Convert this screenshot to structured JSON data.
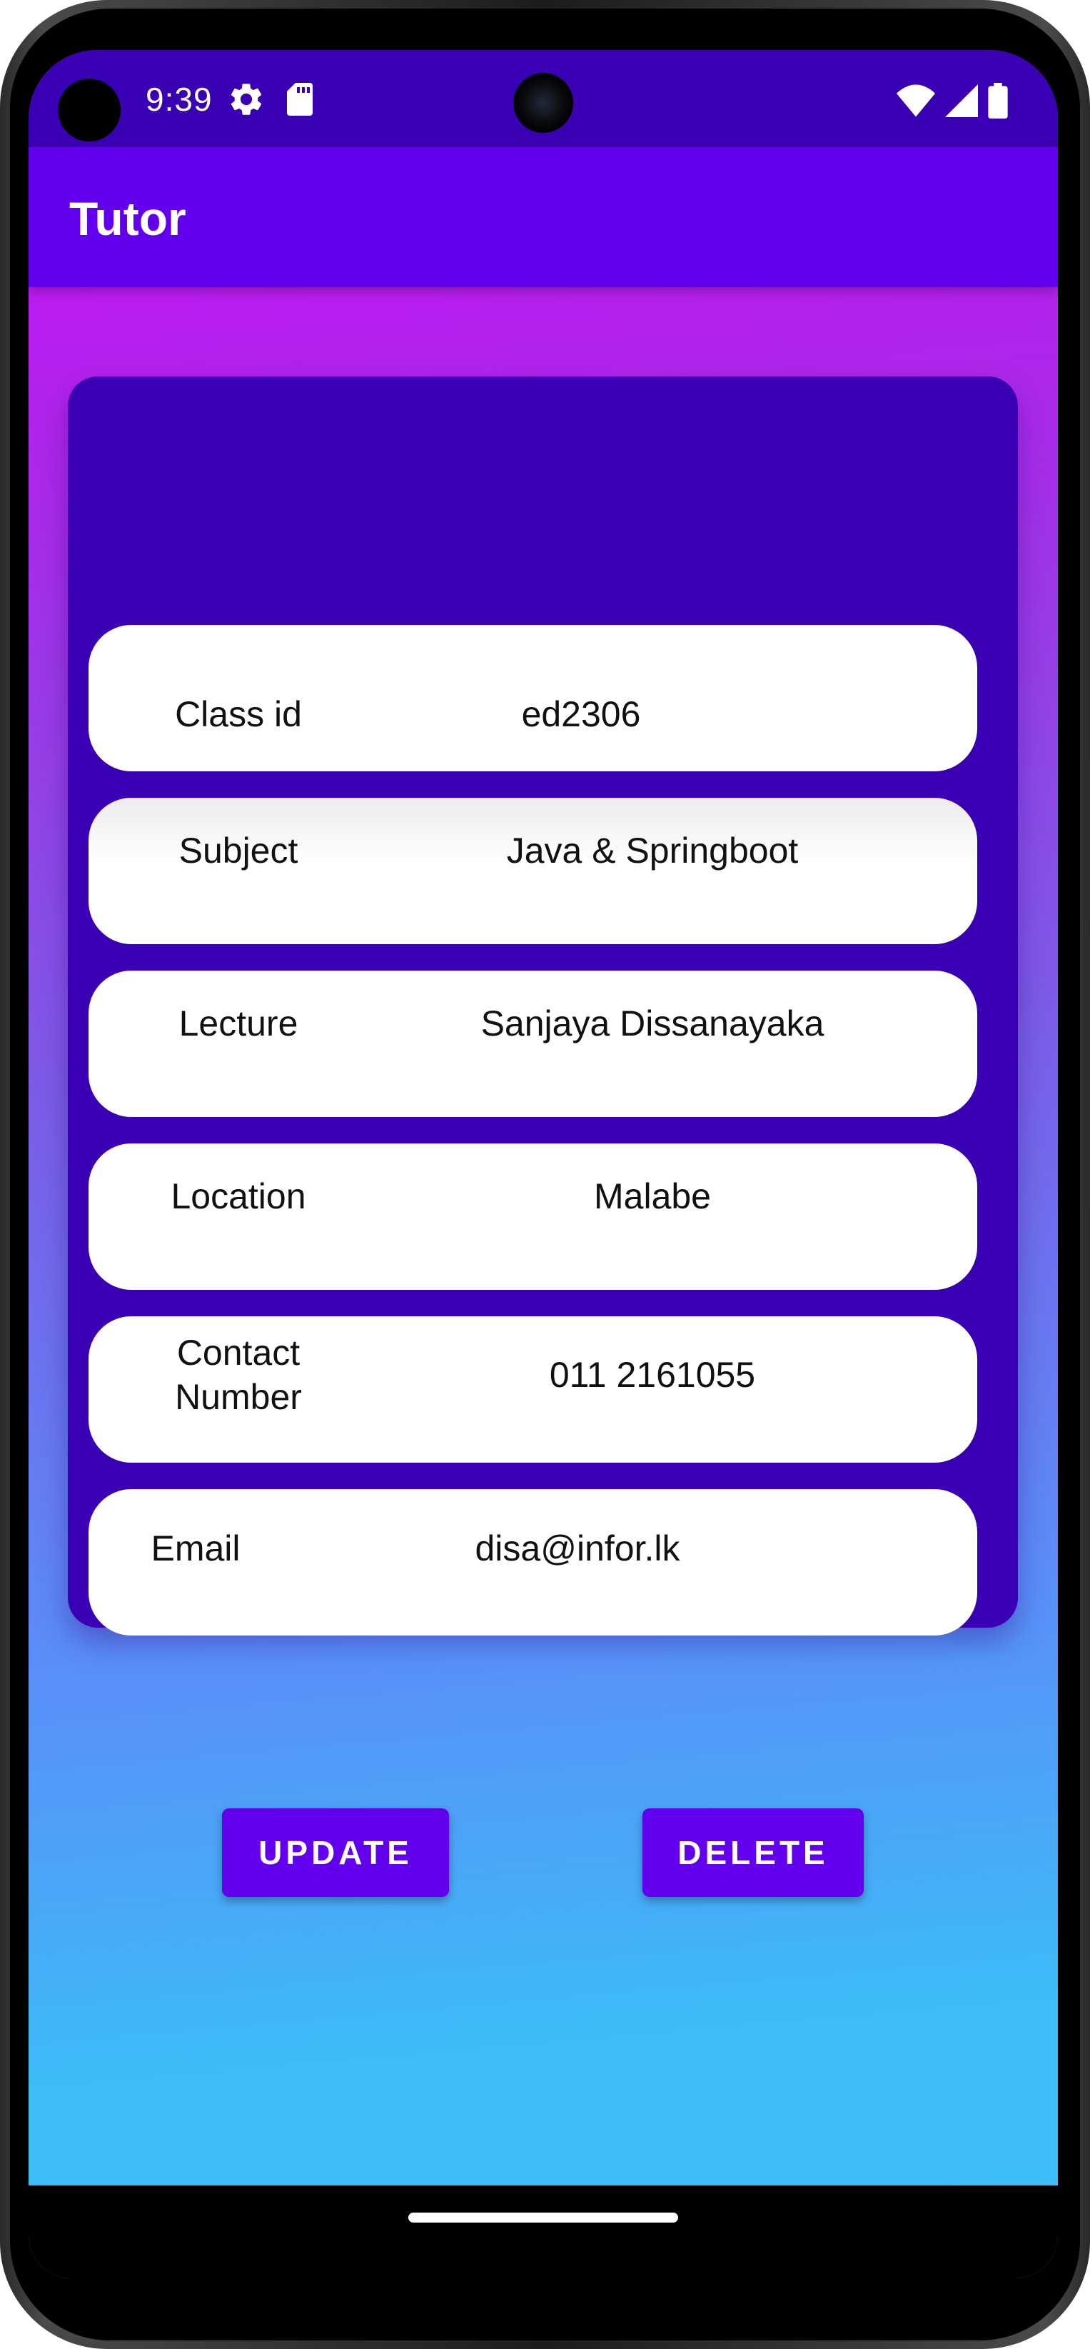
{
  "status_bar": {
    "time": "9:39",
    "icons_left": [
      "settings-gear-icon",
      "sd-card-icon"
    ],
    "icons_right": [
      "wifi-icon",
      "cellular-signal-icon",
      "battery-icon"
    ]
  },
  "app_bar": {
    "title": "Tutor"
  },
  "details": {
    "rows": [
      {
        "label": "Class id",
        "value": "ed2306"
      },
      {
        "label": "Subject",
        "value": "Java & Springboot"
      },
      {
        "label": "Lecture",
        "value": "Sanjaya Dissanayaka"
      },
      {
        "label": "Location",
        "value": "Malabe"
      },
      {
        "label": "Contact Number",
        "value": "011 2161055"
      },
      {
        "label": "Email",
        "value": "disa@infor.lk"
      }
    ]
  },
  "actions": {
    "update_label": "UPDATE",
    "delete_label": "DELETE"
  },
  "colors": {
    "status_bar": "#3a00b3",
    "app_bar": "#6200ee",
    "card": "#3a00b3",
    "button": "#6200ee"
  }
}
